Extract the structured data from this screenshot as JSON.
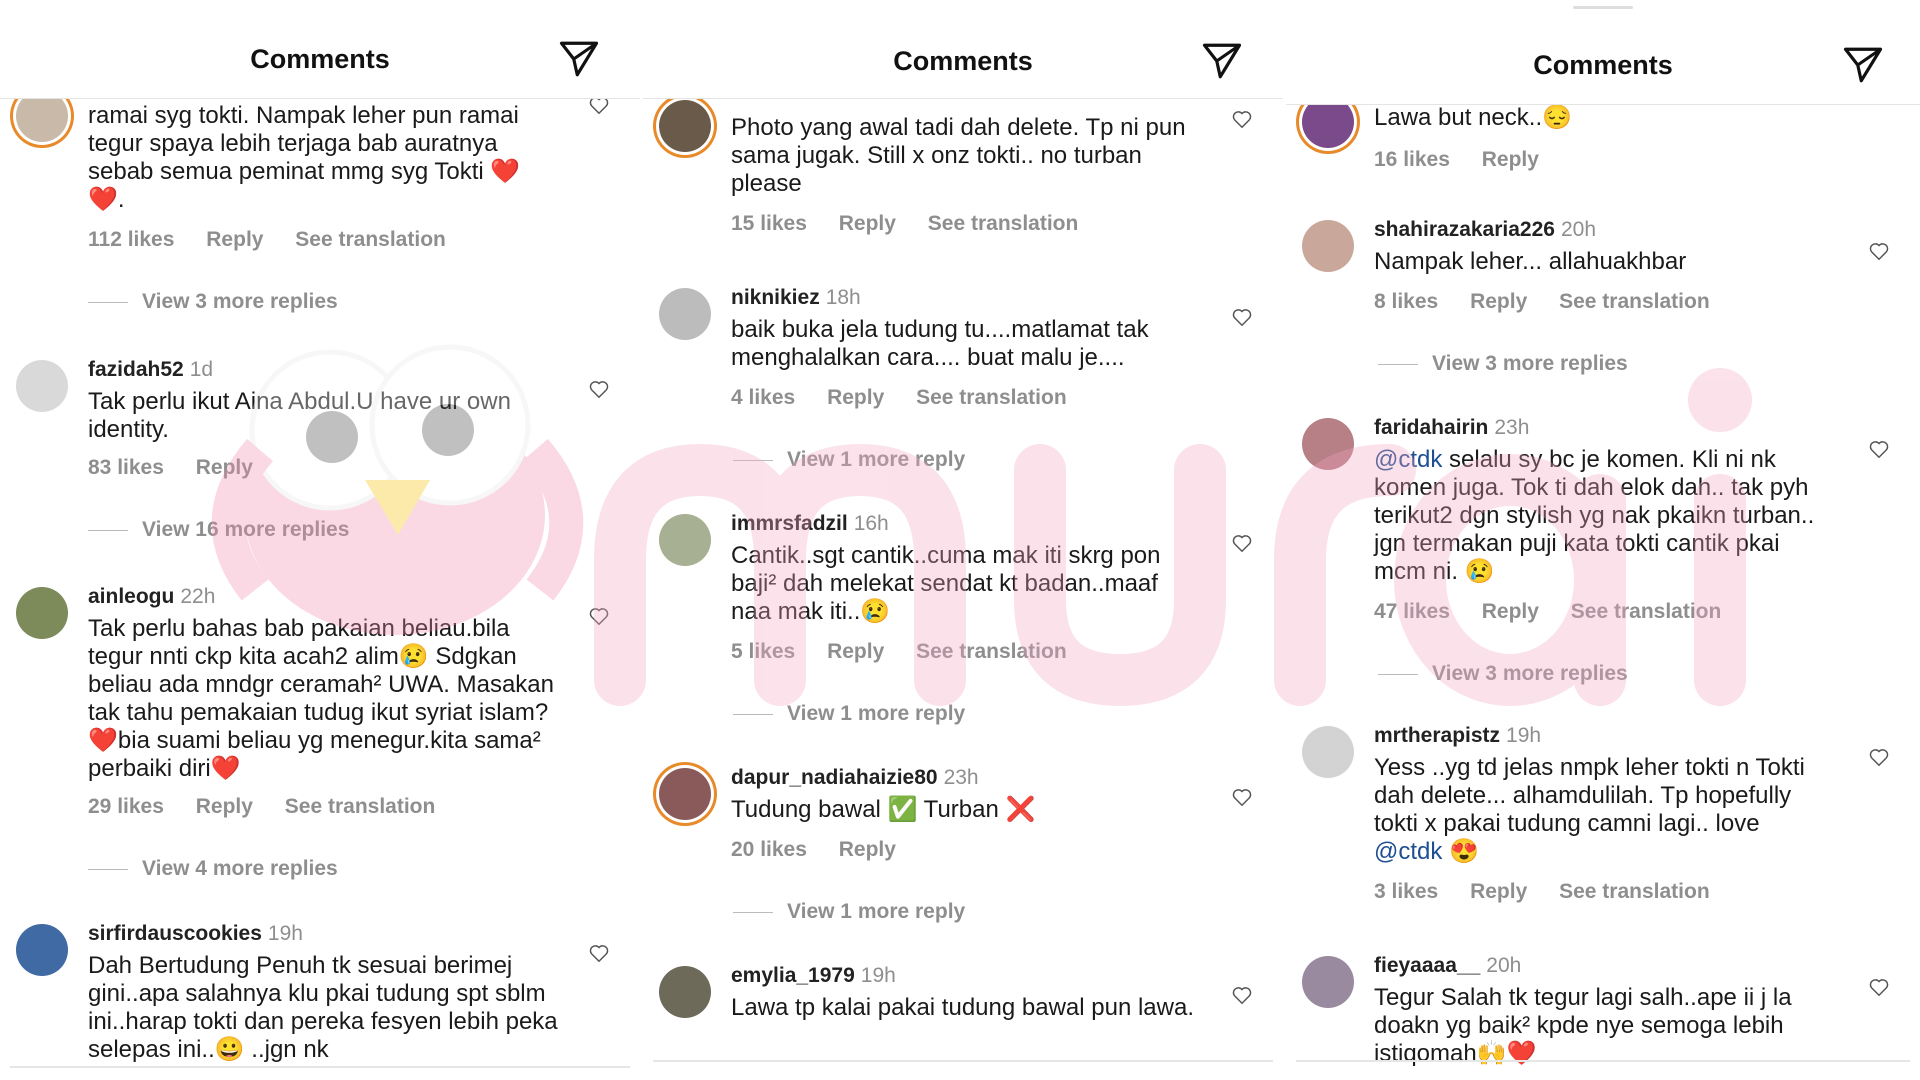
{
  "panels": [
    {
      "title": "Comments",
      "comments": [
        {
          "user": "",
          "time": "",
          "text": "ramai syg tokti. Nampak leher pun ramai tegur spaya lebih terjaga bab auratnya sebab semua peminat mmg syg Tokti ❤️ ❤️.",
          "likes": "112 likes",
          "reply": "Reply",
          "translate": "See translation",
          "more": "View 3 more replies"
        },
        {
          "user": "fazidah52",
          "time": "1d",
          "text": "Tak perlu ikut Aina Abdul.U have ur own identity.",
          "likes": "83 likes",
          "reply": "Reply",
          "translate": "",
          "more": "View 16 more replies"
        },
        {
          "user": "ainleogu",
          "time": "22h",
          "text": "Tak perlu bahas bab pakaian beliau.bila tegur nnti ckp kita acah2 alim😢 Sdgkan beliau ada mndgr ceramah² UWA. Masakan tak tahu pemakaian tudug ikut syriat islam?❤️bia suami  beliau yg menegur.kita sama² perbaiki diri❤️",
          "likes": "29 likes",
          "reply": "Reply",
          "translate": "See translation",
          "more": "View 4 more replies"
        },
        {
          "user": "sirfirdauscookies",
          "time": "19h",
          "text": "Dah Bertudung Penuh tk sesuai berimej gini..apa salahnya klu pkai tudung spt sblm ini..harap tokti  dan pereka fesyen lebih peka selepas ini..😀 ..jgn nk",
          "likes": "",
          "reply": "",
          "translate": "",
          "more": ""
        }
      ]
    },
    {
      "title": "Comments",
      "comments": [
        {
          "user": "",
          "time": "",
          "text": "Photo yang awal tadi dah delete. Tp ni pun sama jugak. Still x onz tokti.. no turban please",
          "likes": "15 likes",
          "reply": "Reply",
          "translate": "See translation",
          "more": ""
        },
        {
          "user": "niknikiez",
          "time": "18h",
          "text": "baik buka jela tudung tu....matlamat tak menghalalkan cara.... buat malu je....",
          "likes": "4 likes",
          "reply": "Reply",
          "translate": "See translation",
          "more": "View 1 more reply"
        },
        {
          "user": "immrsfadzil",
          "time": "16h",
          "text": "Cantik..sgt cantik..cuma mak iti skrg pon baji² dah melekat sendat kt badan..maaf naa mak iti..😢",
          "likes": "5 likes",
          "reply": "Reply",
          "translate": "See translation",
          "more": "View 1 more reply"
        },
        {
          "user": "dapur_nadiahaizie80",
          "time": "23h",
          "text": "Tudung bawal ✅ Turban ❌",
          "likes": "20 likes",
          "reply": "Reply",
          "translate": "",
          "more": "View 1 more reply"
        },
        {
          "user": "emylia_1979",
          "time": "19h",
          "text": "Lawa tp kalai pakai tudung bawal pun lawa.",
          "likes": "",
          "reply": "",
          "translate": "",
          "more": ""
        }
      ]
    },
    {
      "title": "Comments",
      "comments": [
        {
          "user": "",
          "time": "",
          "text": "Lawa but neck..😔",
          "likes": "16 likes",
          "reply": "Reply",
          "translate": "",
          "more": ""
        },
        {
          "user": "shahirazakaria226",
          "time": "20h",
          "text": "Nampak leher... allahuakhbar",
          "likes": "8 likes",
          "reply": "Reply",
          "translate": "See translation",
          "more": "View 3 more replies"
        },
        {
          "user": "faridahairin",
          "time": "23h",
          "mention": "@ctdk",
          "text": " selalu sy bc je komen. Kli ni nk komen juga. Tok ti dah elok dah.. tak pyh terikut2 dgn stylish yg nak pkaikn turban.. jgn termakan puji kata tokti cantik pkai mcm ni. 😢",
          "likes": "47 likes",
          "reply": "Reply",
          "translate": "See translation",
          "more": "View 3 more replies"
        },
        {
          "user": "mrtherapistz",
          "time": "19h",
          "text": "Yess ..yg td jelas nmpk leher tokti n Tokti dah delete... alhamdulilah. Tp hopefully tokti x pakai tudung camni lagi.. love ",
          "mention2": "@ctdk",
          "tail": " 😍",
          "likes": "3 likes",
          "reply": "Reply",
          "translate": "See translation",
          "more": ""
        },
        {
          "user": "fieyaaaa__",
          "time": "20h",
          "text": "Tegur Salah tk tegur lagi  salh..ape ii j la doakn yg baik² kpde nye semoga lebih istiqomah🙌❤️",
          "likes": "",
          "reply": "",
          "translate": "",
          "more": ""
        }
      ]
    }
  ],
  "watermark": "murai",
  "colors": {
    "watermark_pink": "#f3c3d3",
    "muted": "#8e8e8e",
    "mention": "#1d4f91"
  }
}
